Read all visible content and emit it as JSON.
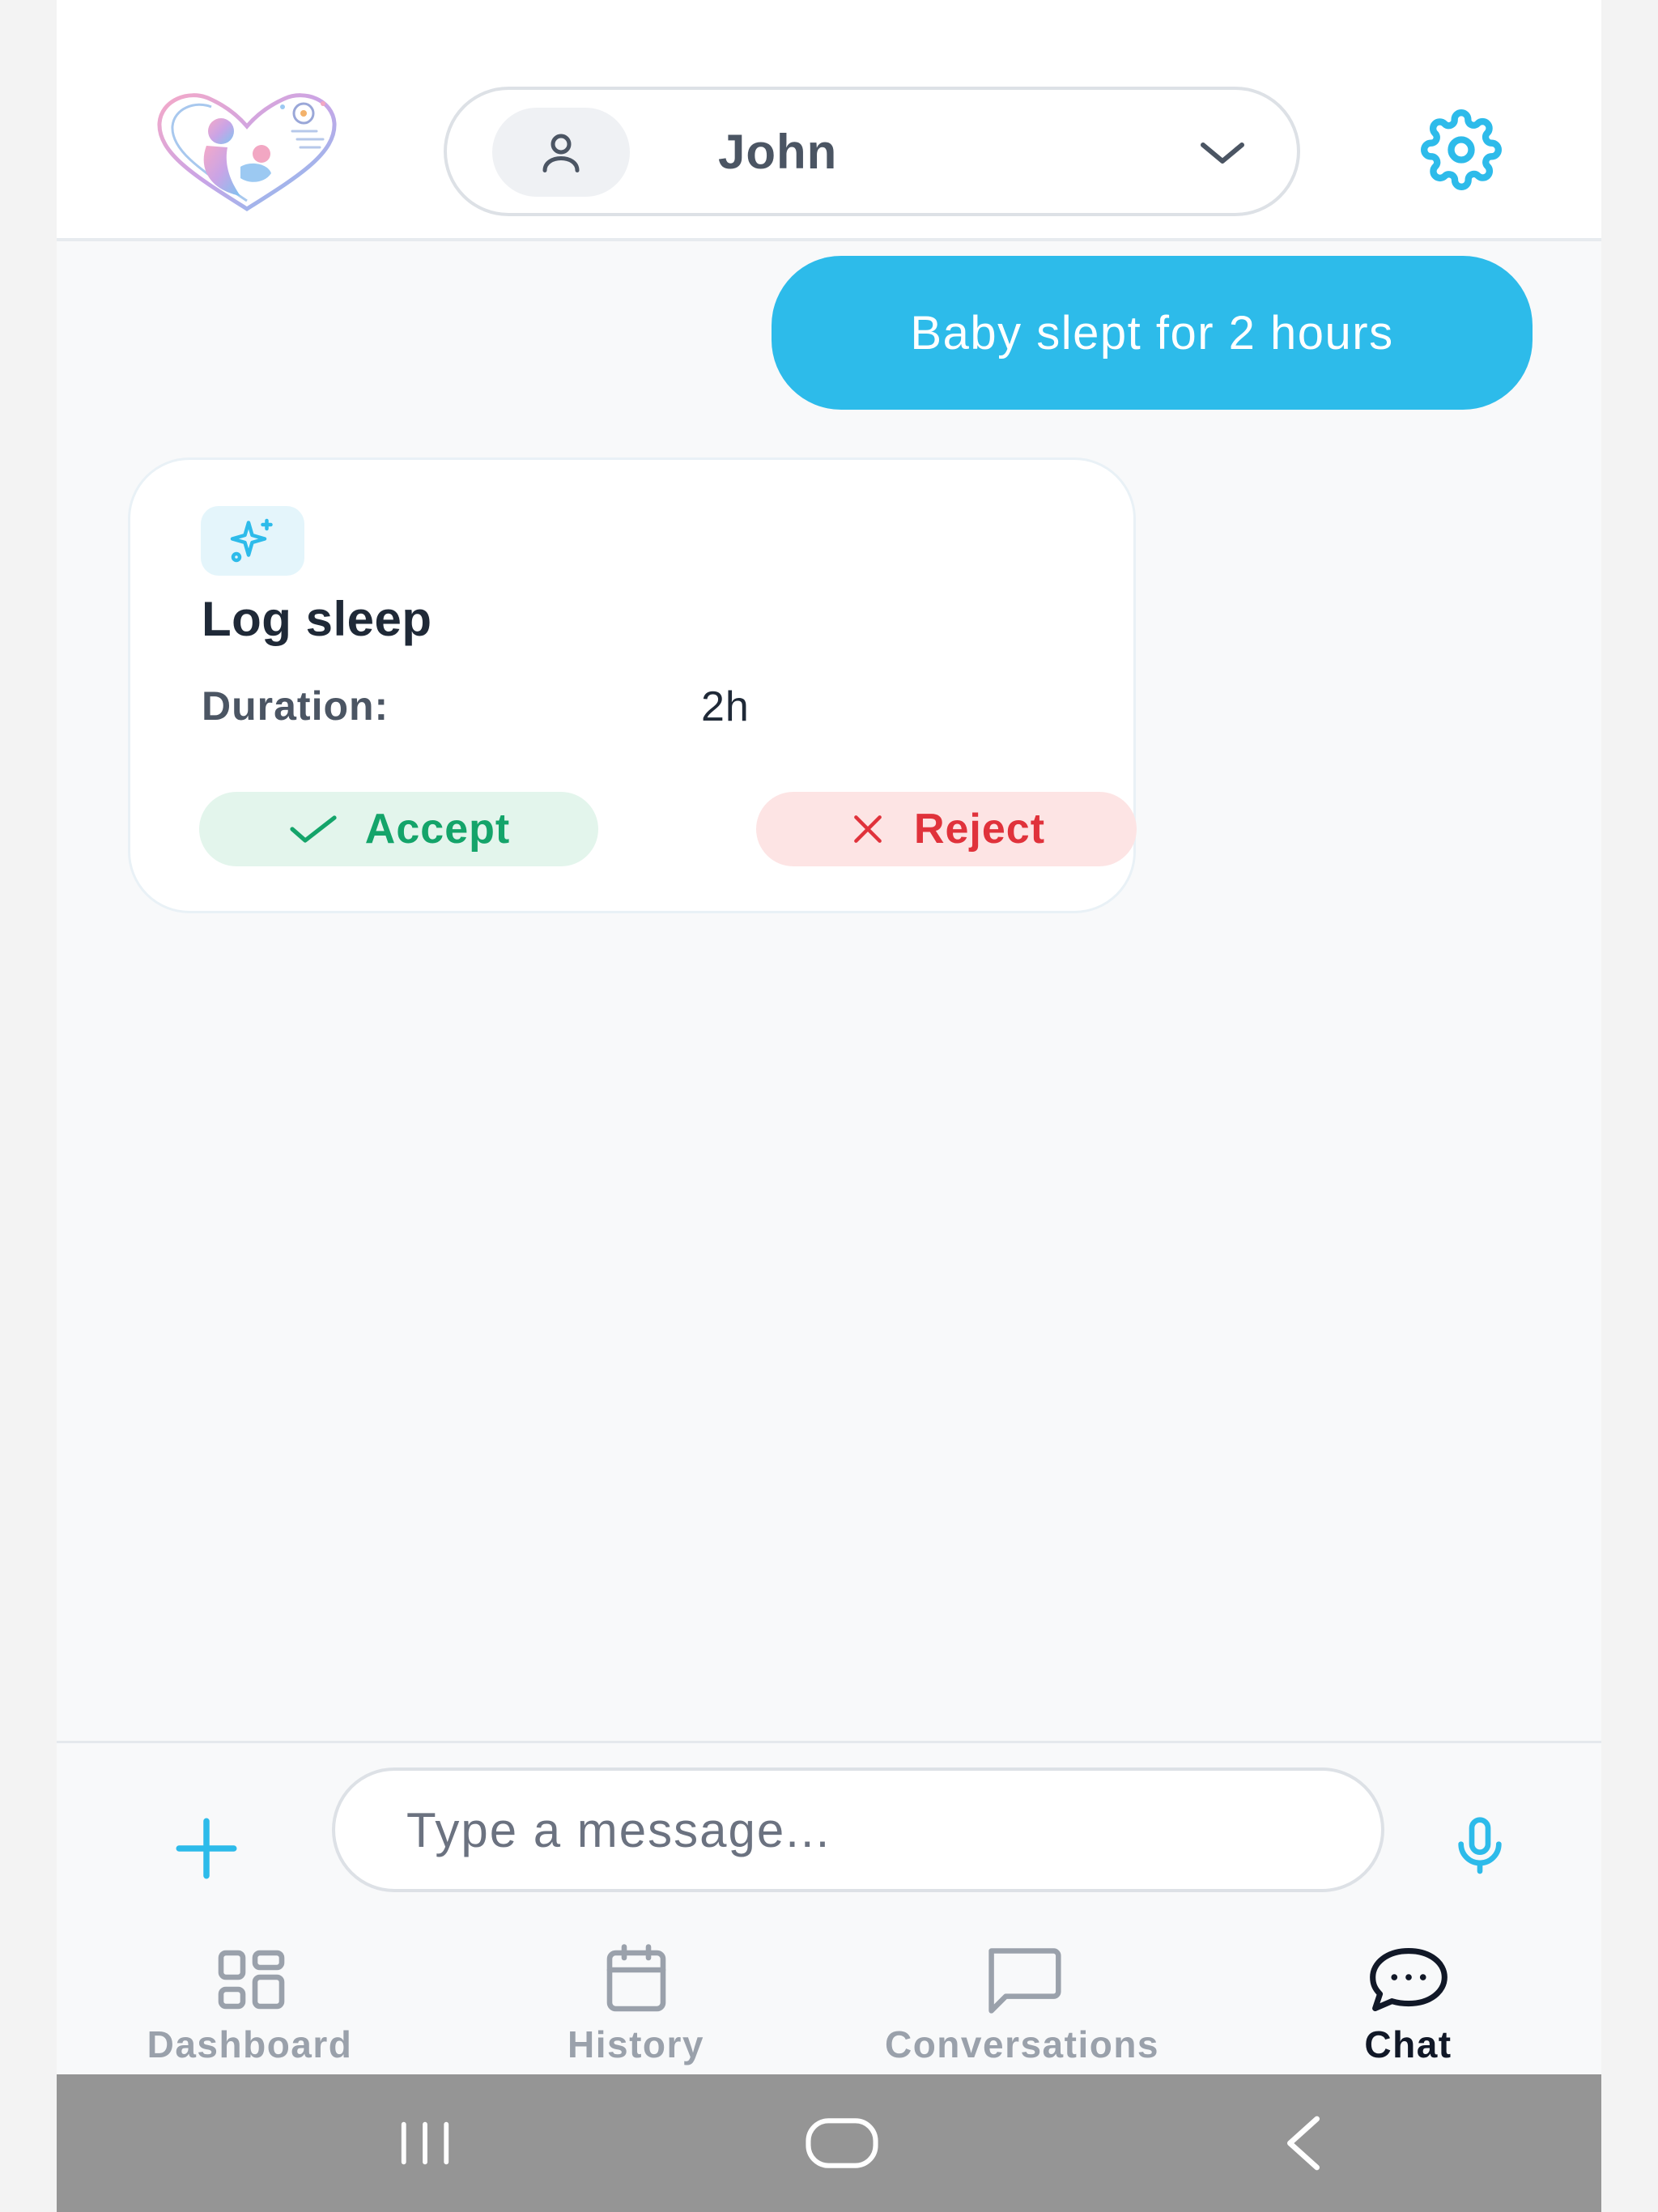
{
  "header": {
    "profile_name": "John"
  },
  "chat": {
    "user_message": "Baby slept for 2 hours"
  },
  "action_card": {
    "title": "Log sleep",
    "duration_label": "Duration:",
    "duration_value": "2h",
    "accept_label": "Accept",
    "reject_label": "Reject"
  },
  "composer": {
    "placeholder": "Type a message..."
  },
  "nav": {
    "items": [
      {
        "label": "Dashboard",
        "icon": "dashboard-icon",
        "active": false
      },
      {
        "label": "History",
        "icon": "calendar-icon",
        "active": false
      },
      {
        "label": "Conversations",
        "icon": "message-square-icon",
        "active": false
      },
      {
        "label": "Chat",
        "icon": "chat-bubble-icon",
        "active": true
      }
    ]
  },
  "colors": {
    "accent": "#2dbbea",
    "accept_text": "#14a46a",
    "accept_bg": "#e3f5ec",
    "reject_text": "#e0323b",
    "reject_bg": "#fde4e4",
    "system_bar": "#959595"
  }
}
